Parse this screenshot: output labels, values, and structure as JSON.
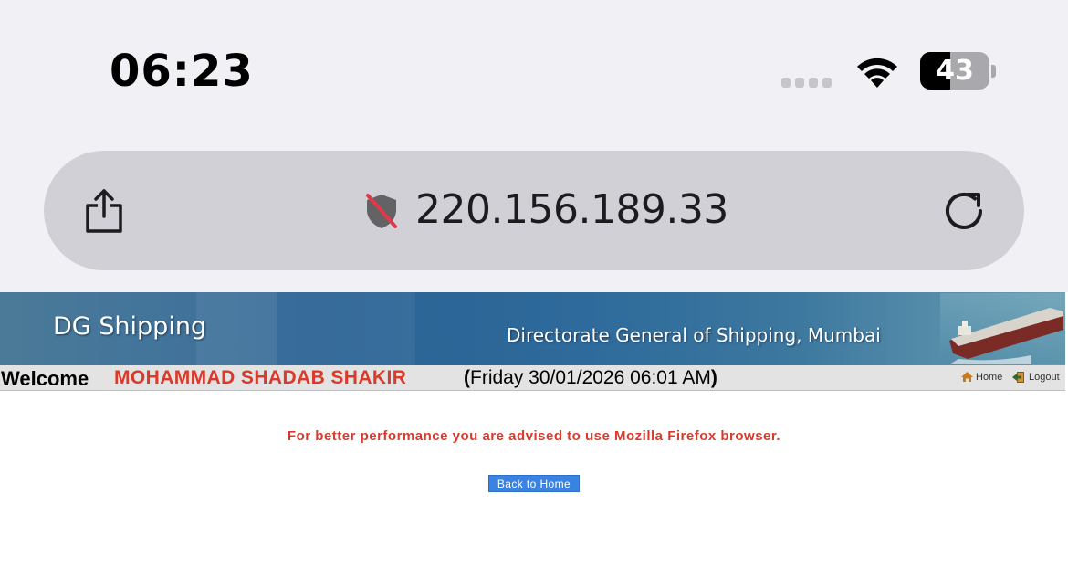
{
  "status_bar": {
    "time": "06:23",
    "battery": "43",
    "battery_level_percent": 43
  },
  "address_bar": {
    "url": "220.156.189.33",
    "icons": [
      "share-icon",
      "shield-slash-icon",
      "reload-icon"
    ]
  },
  "banner": {
    "logo": "DG Shipping",
    "subtitle": "Directorate General of Shipping, Mumbai"
  },
  "welcome_bar": {
    "welcome_label": "Welcome",
    "user_name": "MOHAMMAD SHADAB SHAKIR",
    "paren_open": "(",
    "datetime": "Friday 30/01/2026 06:01 AM",
    "paren_close": ")",
    "home_label": "Home",
    "logout_label": "Logout"
  },
  "main": {
    "notice": "For better performance you are advised to use Mozilla Firefox browser.",
    "back_button_label": "Back to Home"
  },
  "colors": {
    "accent_red": "#d93a2b",
    "button_blue": "#3b83e3",
    "banner_blue": "#2a6294"
  }
}
